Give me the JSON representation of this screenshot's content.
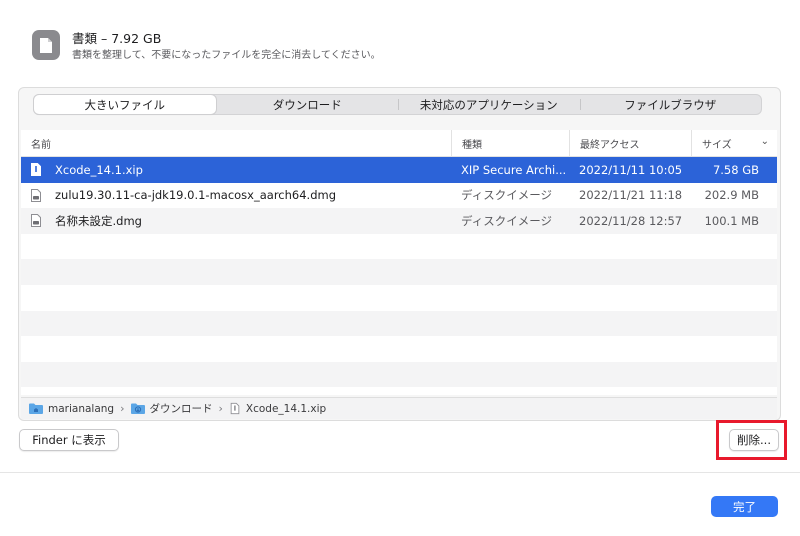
{
  "header": {
    "title": "書類 – 7.92 GB",
    "subtitle": "書類を整理して、不要になったファイルを完全に消去してください。",
    "icon": "document-icon"
  },
  "tabs": [
    {
      "label": "大きいファイル",
      "active": true
    },
    {
      "label": "ダウンロード",
      "active": false
    },
    {
      "label": "未対応のアプリケーション",
      "active": false
    },
    {
      "label": "ファイルブラウザ",
      "active": false
    }
  ],
  "table": {
    "columns": [
      "名前",
      "種類",
      "最終アクセス",
      "サイズ"
    ],
    "rows": [
      {
        "name": "Xcode_14.1.xip",
        "kind": "XIP Secure Archi...",
        "accessed": "2022/11/11 10:05",
        "size": "7.58 GB",
        "selected": true
      },
      {
        "name": "zulu19.30.11-ca-jdk19.0.1-macosx_aarch64.dmg",
        "kind": "ディスクイメージ",
        "accessed": "2022/11/21 11:18",
        "size": "202.9 MB",
        "selected": false
      },
      {
        "name": "名称未設定.dmg",
        "kind": "ディスクイメージ",
        "accessed": "2022/11/28 12:57",
        "size": "100.1 MB",
        "selected": false
      }
    ]
  },
  "pathbar": {
    "items": [
      {
        "label": "marianalang",
        "icon": "home-folder-icon"
      },
      {
        "label": "ダウンロード",
        "icon": "downloads-folder-icon"
      },
      {
        "label": "Xcode_14.1.xip",
        "icon": "file-icon"
      }
    ],
    "separator": "›"
  },
  "buttons": {
    "finder": "Finder に表示",
    "delete": "削除...",
    "done": "完了"
  },
  "colors": {
    "selection": "#2c63d8",
    "accent": "#3478f6",
    "highlight": "#e8192c"
  }
}
